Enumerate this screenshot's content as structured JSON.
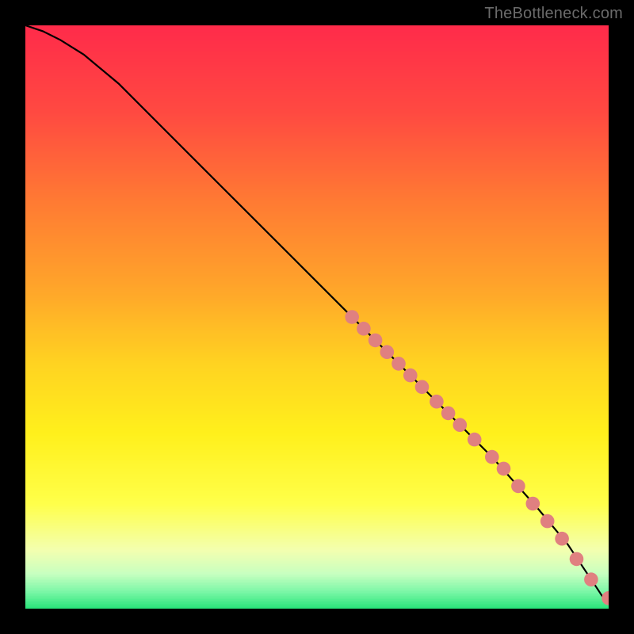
{
  "attribution": "TheBottleneck.com",
  "chart_data": {
    "type": "line",
    "title": "",
    "xlabel": "",
    "ylabel": "",
    "xlim": [
      0,
      100
    ],
    "ylim": [
      0,
      100
    ],
    "grid": false,
    "legend": false,
    "background_gradient": {
      "stops": [
        {
          "t": 0.0,
          "color": "#ff2b4a"
        },
        {
          "t": 0.15,
          "color": "#ff4a41"
        },
        {
          "t": 0.3,
          "color": "#ff7a33"
        },
        {
          "t": 0.45,
          "color": "#ffa52a"
        },
        {
          "t": 0.58,
          "color": "#ffd321"
        },
        {
          "t": 0.7,
          "color": "#fff01c"
        },
        {
          "t": 0.82,
          "color": "#ffff4a"
        },
        {
          "t": 0.9,
          "color": "#f3ffb0"
        },
        {
          "t": 0.94,
          "color": "#c8ffc0"
        },
        {
          "t": 0.97,
          "color": "#7ef7a8"
        },
        {
          "t": 1.0,
          "color": "#28e57a"
        }
      ]
    },
    "series": [
      {
        "name": "curve",
        "color": "#000000",
        "x": [
          0,
          3,
          6,
          10,
          16,
          24,
          34,
          46,
          58,
          70,
          80,
          88,
          93,
          96,
          98,
          99,
          100
        ],
        "y": [
          100,
          99,
          97.5,
          95,
          90,
          82,
          72,
          60,
          48,
          36,
          26,
          17,
          11,
          6.5,
          3.5,
          2,
          1.8
        ]
      }
    ],
    "markers": {
      "name": "highlight-segment",
      "color": "#e08080",
      "radius_frac": 0.012,
      "points": [
        {
          "x": 56,
          "y": 50
        },
        {
          "x": 58,
          "y": 48
        },
        {
          "x": 60,
          "y": 46
        },
        {
          "x": 62,
          "y": 44
        },
        {
          "x": 64,
          "y": 42
        },
        {
          "x": 66,
          "y": 40
        },
        {
          "x": 68,
          "y": 38
        },
        {
          "x": 70.5,
          "y": 35.5
        },
        {
          "x": 72.5,
          "y": 33.5
        },
        {
          "x": 74.5,
          "y": 31.5
        },
        {
          "x": 77,
          "y": 29
        },
        {
          "x": 80,
          "y": 26
        },
        {
          "x": 82,
          "y": 24
        },
        {
          "x": 84.5,
          "y": 21
        },
        {
          "x": 87,
          "y": 18
        },
        {
          "x": 89.5,
          "y": 15
        },
        {
          "x": 92,
          "y": 12
        },
        {
          "x": 94.5,
          "y": 8.5
        },
        {
          "x": 97,
          "y": 5
        },
        {
          "x": 100,
          "y": 1.8
        }
      ]
    }
  }
}
